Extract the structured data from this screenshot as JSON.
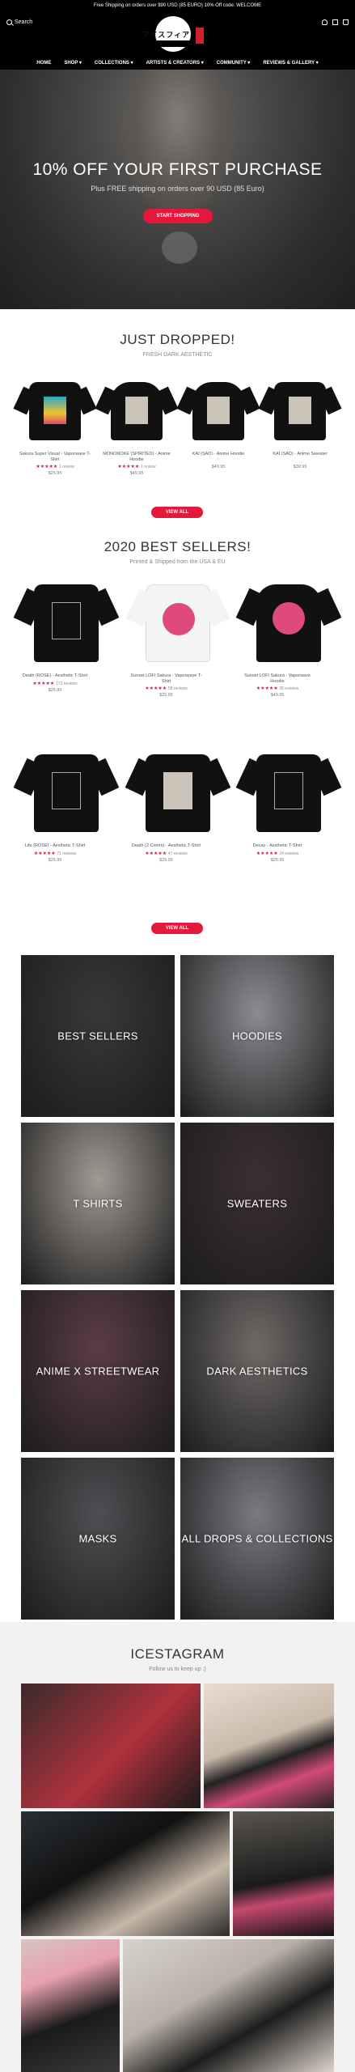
{
  "announcement": "Free Shipping on orders over $90 USD (85 EURO) 10% Off code: WELCOME",
  "header": {
    "search_label": "Search",
    "logo_text": "アイスフィア",
    "nav": [
      "HOME",
      "SHOP ▾",
      "COLLECTIONS ▾",
      "ARTISTS & CREATORS ▾",
      "COMMUNITY ▾",
      "REVIEWS & GALLERY ▾"
    ]
  },
  "hero": {
    "title": "10% OFF YOUR FIRST PURCHASE",
    "subtitle": "Plus FREE shipping on orders over 90 USD (85 Euro)",
    "cta": "START SHOPPING"
  },
  "just_dropped": {
    "title": "JUST DROPPED!",
    "subtitle": "FRESH DARK AESTHETIC",
    "products": [
      {
        "name": "Sakura Super Visual - Vaporwave T-Shirt",
        "stars": "★★★★★",
        "reviews": "1 review",
        "price": "$25.95",
        "print": "poster"
      },
      {
        "name": "MONONOKE (SPIRITED) - Anime Hoodie",
        "stars": "★★★★★",
        "reviews": "1 review",
        "price": "$49.95",
        "print": "gray"
      },
      {
        "name": "KAI (SAD) - Anime Hoodie",
        "stars": "",
        "reviews": "",
        "price": "$49.95",
        "print": "gray"
      },
      {
        "name": "KAI (SAD) - Anime Sweater",
        "stars": "",
        "reviews": "",
        "price": "$39.95",
        "print": "gray"
      }
    ],
    "view_all": "VIEW ALL"
  },
  "best_sellers": {
    "title": "2020 BEST SELLERS!",
    "subtitle": "Printed & Shipped from the USA & EU",
    "products": [
      {
        "name": "Death (ROSE) - Aesthetic T-Shirt",
        "stars": "★★★★★",
        "reviews": "172 reviews",
        "price": "$25.95",
        "color": "black",
        "print": "frame"
      },
      {
        "name": "Sunset LOFI Sakura - Vaporwave T-Shirt",
        "stars": "★★★★★",
        "reviews": "58 reviews",
        "price": "$25.95",
        "color": "white",
        "print": "pink"
      },
      {
        "name": "Sunset LOFI Sakura - Vaporwave Hoodie",
        "stars": "★★★★★",
        "reviews": "26 reviews",
        "price": "$49.95",
        "color": "black",
        "print": "pink"
      },
      {
        "name": "Life (ROSE) - Aesthetic T-Shirt",
        "stars": "★★★★★",
        "reviews": "71 reviews",
        "price": "$25.95",
        "color": "black",
        "print": "frame"
      },
      {
        "name": "Death (2 Colors) - Aesthetic T-Shirt",
        "stars": "★★★★★",
        "reviews": "47 reviews",
        "price": "$25.95",
        "color": "black",
        "print": "gray"
      },
      {
        "name": "Decay - Aesthetic T-Shirt",
        "stars": "★★★★★",
        "reviews": "24 reviews",
        "price": "$25.95",
        "color": "black",
        "print": "frame"
      }
    ],
    "view_all": "VIEW ALL"
  },
  "collections": [
    {
      "label": "BEST SELLERS",
      "bg": "#3a3837"
    },
    {
      "label": "HOODIES",
      "bg": "#8a8c90"
    },
    {
      "label": "T SHIRTS",
      "bg": "#a09a94"
    },
    {
      "label": "SWEATERS",
      "bg": "#3c2f33"
    },
    {
      "label": "ANIME X STREETWEAR",
      "bg": "#5a3c48"
    },
    {
      "label": "DARK AESTHETICS",
      "bg": "#6e6a68"
    },
    {
      "label": "MASKS",
      "bg": "#4d4f52"
    },
    {
      "label": "ALL DROPS & COLLECTIONS",
      "bg": "#7a7a82"
    }
  ],
  "icestagram": {
    "title": "ICESTAGRAM",
    "subtitle": "Follow us to keep up :)"
  }
}
